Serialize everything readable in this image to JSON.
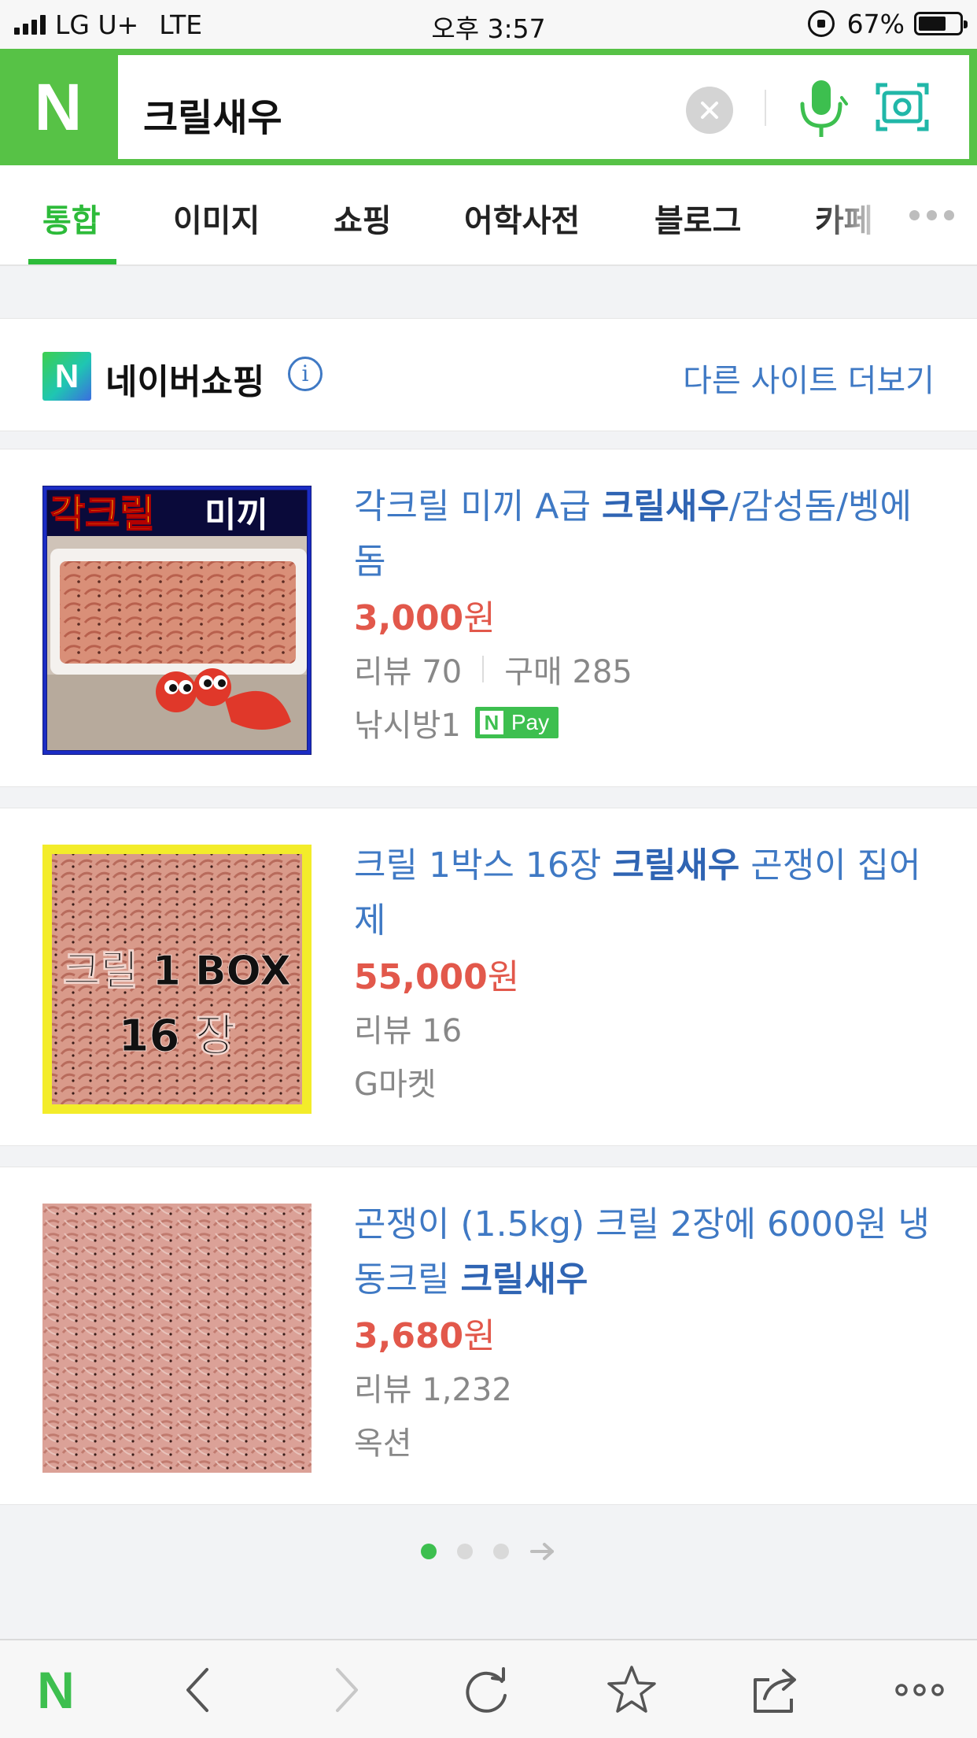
{
  "status_bar": {
    "carrier": "LG U+",
    "network": "LTE",
    "time": "오후 3:57",
    "battery": "67%",
    "battery_level": 0.67
  },
  "search": {
    "logo": "N",
    "query": "크릴새우",
    "clear_icon": "close-icon",
    "voice_icon": "microphone-icon",
    "lens_icon": "camera-search-icon",
    "brand_color": "#57c246"
  },
  "tabs": [
    {
      "label": "통합",
      "active": true
    },
    {
      "label": "이미지"
    },
    {
      "label": "쇼핑"
    },
    {
      "label": "어학사전"
    },
    {
      "label": "블로그"
    },
    {
      "label": "카페"
    }
  ],
  "shopping": {
    "logo": "N",
    "title": "네이버쇼핑",
    "more_sites": "다른 사이트 더보기"
  },
  "products": [
    {
      "title_before": "각크릴 미끼 A급 ",
      "title_highlight": "크릴새우",
      "title_after": "/감성돔/벵에돔",
      "price": "3,000",
      "price_unit": "원",
      "reviews": "리뷰 70",
      "purchases": "구매 285",
      "seller": "낚시방1",
      "badge_logo": "N",
      "badge_text": "Pay",
      "image_text_1": "각크릴",
      "image_text_2": "미끼"
    },
    {
      "title_before": "크릴 1박스 16장 ",
      "title_highlight": "크릴새우",
      "title_after": " 곤쟁이 집어제",
      "price": "55,000",
      "price_unit": "원",
      "reviews": "리뷰 16",
      "seller": "G마켓",
      "image_text_1": "크릴 1 BOX",
      "image_text_2": "16 장"
    },
    {
      "title_before": "곤쟁이 (1.5kg) 크릴 2장에 6000원 냉동크릴 ",
      "title_highlight": "크릴새우",
      "title_after": "",
      "price": "3,680",
      "price_unit": "원",
      "reviews": "리뷰 1,232",
      "seller": "옥션"
    }
  ],
  "pagination": {
    "pages": 3,
    "current": 1,
    "next_icon": "arrow-right-icon"
  },
  "toolbar": {
    "logo": "N",
    "items": [
      "back-icon",
      "forward-icon",
      "refresh-icon",
      "bookmark-star-icon",
      "share-icon",
      "more-icon"
    ]
  },
  "colors": {
    "accent_green": "#2dbb3a",
    "link_blue": "#3f79c4",
    "price_red": "#e2584b"
  }
}
